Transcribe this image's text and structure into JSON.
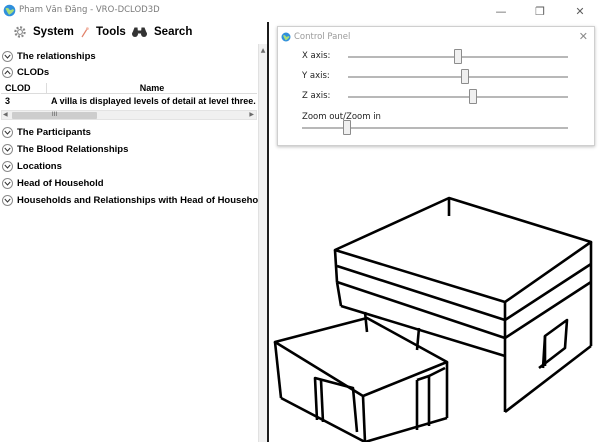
{
  "window": {
    "title": "Pham Văn Đăng - VRO-DCLOD3D",
    "minimize_glyph": "—",
    "maximize_glyph": "❐",
    "close_glyph": "✕"
  },
  "menu": {
    "system": "System",
    "tools": "Tools",
    "search": "Search"
  },
  "tree": {
    "relationships": "The relationships",
    "clods": "CLODs",
    "participants": "The Participants",
    "blood": "The Blood Relationships",
    "locations": "Locations",
    "head": "Head of Household",
    "households": "Households and Relationships with Head of Household"
  },
  "clod_table": {
    "columns": [
      "CLOD",
      "Name"
    ],
    "rows": [
      {
        "clod": "3",
        "name": "A villa is displayed levels of detail at level three."
      }
    ],
    "scroll_thumb": "III"
  },
  "control_panel": {
    "title": "Control Panel",
    "close_glyph": "✕",
    "x_axis": {
      "label": "X axis:",
      "value": 0.5
    },
    "y_axis": {
      "label": "Y axis:",
      "value": 0.53
    },
    "z_axis": {
      "label": "Z axis:",
      "value": 0.57
    },
    "zoom": {
      "label": "Zoom out/Zoom in",
      "value": 0.17
    }
  },
  "colors": {
    "accent": "#1e88d8",
    "model_stroke": "#000000",
    "menu_gear": "#888888",
    "binoculars": "#333333"
  }
}
